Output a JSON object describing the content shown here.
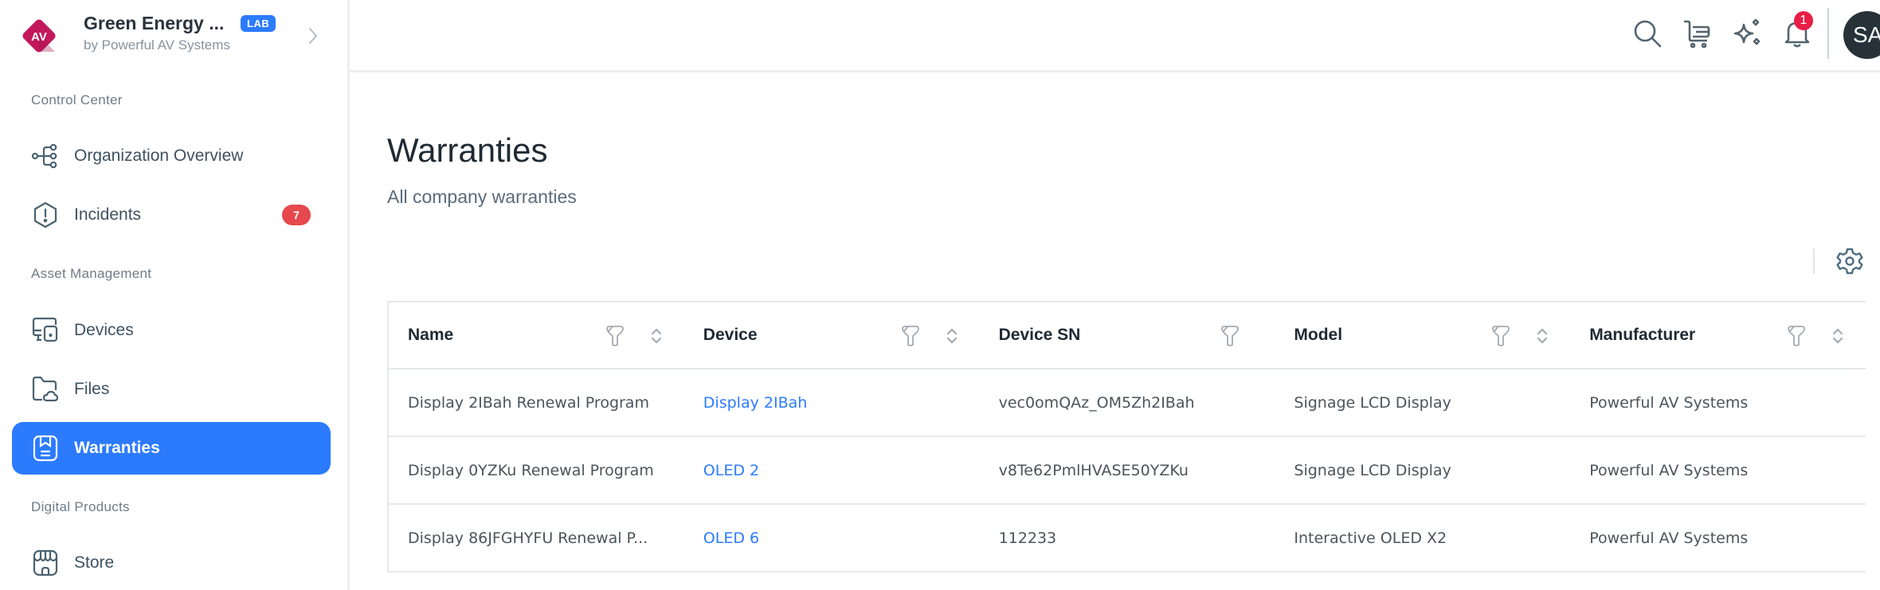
{
  "brand": {
    "title": "Green Energy ...",
    "badge": "LAB",
    "subtitle": "by Powerful AV Systems",
    "logo_text": "AV",
    "logo_color": "#c2185b"
  },
  "sidebar": {
    "sections": [
      {
        "label": "Control Center",
        "items": [
          {
            "label": "Organization Overview",
            "icon": "hierarchy-icon",
            "active": false
          },
          {
            "label": "Incidents",
            "icon": "alert-hexagon-icon",
            "badge": "7",
            "active": false
          }
        ]
      },
      {
        "label": "Asset Management",
        "items": [
          {
            "label": "Devices",
            "icon": "devices-icon",
            "active": false
          },
          {
            "label": "Files",
            "icon": "folder-cloud-icon",
            "active": false
          },
          {
            "label": "Warranties",
            "icon": "warranty-icon",
            "active": true
          }
        ]
      },
      {
        "label": "Digital Products",
        "items": [
          {
            "label": "Store",
            "icon": "store-icon",
            "active": false
          }
        ]
      }
    ]
  },
  "header": {
    "icons": [
      "search-icon",
      "cart-icon",
      "sparkles-icon",
      "bell-icon"
    ],
    "notification_count": "1",
    "avatar_initials": "SA"
  },
  "page": {
    "title": "Warranties",
    "subtitle": "All company warranties"
  },
  "table": {
    "columns": [
      {
        "label": "Name",
        "filter": true,
        "sort": true
      },
      {
        "label": "Device",
        "filter": true,
        "sort": true
      },
      {
        "label": "Device SN",
        "filter": true,
        "sort": false
      },
      {
        "label": "Model",
        "filter": true,
        "sort": true
      },
      {
        "label": "Manufacturer",
        "filter": true,
        "sort": true
      }
    ],
    "rows": [
      {
        "name": "Display 2IBah Renewal Program",
        "device": "Display 2IBah",
        "device_sn": "vec0omQAz_OM5Zh2IBah",
        "model": "Signage LCD Display",
        "manufacturer": "Powerful AV Systems"
      },
      {
        "name": "Display 0YZKu Renewal Program",
        "device": "OLED 2",
        "device_sn": "v8Te62PmlHVASE50YZKu",
        "model": "Signage LCD Display",
        "manufacturer": "Powerful AV Systems"
      },
      {
        "name": "Display 86JFGHYFU Renewal P...",
        "device": "OLED 6",
        "device_sn": "112233",
        "model": "Interactive OLED X2",
        "manufacturer": "Powerful AV Systems"
      }
    ]
  },
  "colors": {
    "accent": "#2c7bfd",
    "incident_badge": "#e5484d",
    "notification_badge": "#e81f47",
    "avatar_bg": "#263238"
  }
}
